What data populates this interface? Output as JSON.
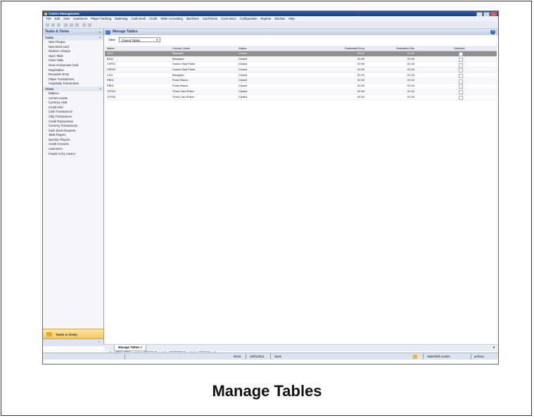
{
  "app": {
    "title": "Casino Management"
  },
  "menu": [
    "File",
    "Edit",
    "View",
    "Customers",
    "Player Tracking",
    "Marketing",
    "Cash Desk",
    "Credit",
    "Table Accounting",
    "Machines",
    "Card Room",
    "Corrections",
    "Configuration",
    "Reports",
    "Window",
    "Help"
  ],
  "nav": {
    "header": "Tasks & Views",
    "tasks_label": "Tasks",
    "tasks": [
      "New Cheque",
      "New Debit Card",
      "Redeem Cheque",
      "Open Table",
      "Close Table",
      "Issue Anonymous Card",
      "Registration",
      "Reception Entry",
      "Player Transactions",
      "Hospitality Transactions"
    ],
    "views_label": "Views",
    "views": [
      "Balance",
      "Current Assets",
      "Currency Held",
      "Credit Held",
      "Cash Transactions",
      "Chip Transactions",
      "Credit Transactions",
      "Currency Transactions",
      "Cash Desk Requests",
      "Table Players",
      "Machine Players",
      "Credit Accounts",
      "Customers",
      "People in the Casino"
    ],
    "bottom_label": "Tasks & Views"
  },
  "main": {
    "title": "Manage Tables",
    "view_label": "View:",
    "view_value": "Closed Tables",
    "columns": [
      "Name",
      "Current Game",
      "Status",
      "Estimated Drop",
      "Estimated Win",
      "Selected"
    ],
    "rows": [
      {
        "name": "BJ01",
        "game": "Blackjack",
        "status": "Closed",
        "drop": "£0.00",
        "win": "£0.00",
        "selected": true
      },
      {
        "name": "BJ02",
        "game": "Blackjack",
        "status": "Closed",
        "drop": "£0.00",
        "win": "£0.00",
        "selected": false
      },
      {
        "name": "CSP01",
        "game": "Casino Stud Poker",
        "status": "Closed",
        "drop": "£0.00",
        "win": "£0.00",
        "selected": false
      },
      {
        "name": "CSP02",
        "game": "Casino Stud Poker",
        "status": "Closed",
        "drop": "£0.00",
        "win": "£0.00",
        "selected": false
      },
      {
        "name": "LT01",
        "game": "Blackjack",
        "status": "Closed",
        "drop": "£0.00",
        "win": "£0.00",
        "selected": false
      },
      {
        "name": "PB01",
        "game": "Punto Banco",
        "status": "Closed",
        "drop": "£0.00",
        "win": "£0.00",
        "selected": false
      },
      {
        "name": "PB02",
        "game": "Punto Banco",
        "status": "Closed",
        "drop": "£0.00",
        "win": "£0.00",
        "selected": false
      },
      {
        "name": "TCP01",
        "game": "Three Card Poker",
        "status": "Closed",
        "drop": "£0.00",
        "win": "£0.00",
        "selected": false
      },
      {
        "name": "TCP02",
        "game": "Three Card Poker",
        "status": "Closed",
        "drop": "£0.00",
        "win": "£0.00",
        "selected": false
      }
    ],
    "buttons": {
      "open": "Open Table",
      "select_all": "Select All",
      "deselect_all": "Deselect All",
      "refresh": "Refresh"
    },
    "tab_label": "Manage Tables ×"
  },
  "status": {
    "location": "MAIN",
    "date": "18/01/2011",
    "state": "Open",
    "casino": "Wakefield Casino",
    "user": "pefman"
  },
  "caption": "Manage Tables"
}
